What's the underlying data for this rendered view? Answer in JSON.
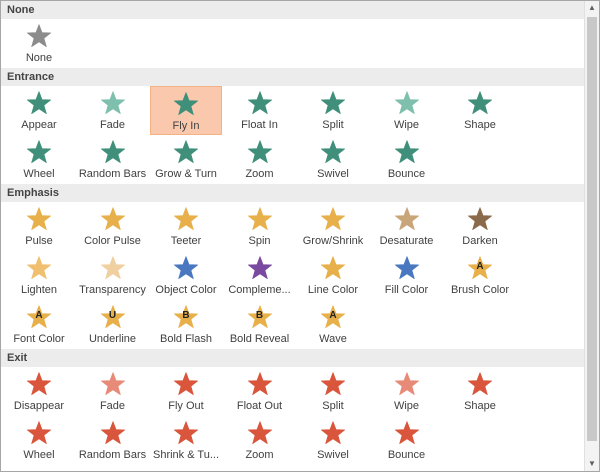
{
  "sections": [
    {
      "title": "None",
      "items": [
        {
          "label": "None",
          "icon": "star-gray-icon",
          "color": "#8c8c8c"
        }
      ]
    },
    {
      "title": "Entrance",
      "items": [
        {
          "label": "Appear",
          "icon": "star-appear-icon",
          "color": "#3f8f7a"
        },
        {
          "label": "Fade",
          "icon": "star-fade-icon",
          "color": "#7fbfae"
        },
        {
          "label": "Fly In",
          "icon": "star-fly-in-icon",
          "color": "#3f8f7a",
          "selected": true
        },
        {
          "label": "Float In",
          "icon": "star-float-in-icon",
          "color": "#3f8f7a"
        },
        {
          "label": "Split",
          "icon": "star-split-icon",
          "color": "#3f8f7a"
        },
        {
          "label": "Wipe",
          "icon": "star-wipe-icon",
          "color": "#7fbfae"
        },
        {
          "label": "Shape",
          "icon": "star-shape-icon",
          "color": "#3f8f7a"
        },
        {
          "label": "Wheel",
          "icon": "star-wheel-icon",
          "color": "#3f8f7a"
        },
        {
          "label": "Random Bars",
          "icon": "star-random-bars-icon",
          "color": "#3f8f7a"
        },
        {
          "label": "Grow & Turn",
          "icon": "star-grow-turn-icon",
          "color": "#3f8f7a"
        },
        {
          "label": "Zoom",
          "icon": "star-zoom-icon",
          "color": "#3f8f7a"
        },
        {
          "label": "Swivel",
          "icon": "star-swivel-icon",
          "color": "#3f8f7a"
        },
        {
          "label": "Bounce",
          "icon": "star-bounce-icon",
          "color": "#3f8f7a"
        }
      ]
    },
    {
      "title": "Emphasis",
      "items": [
        {
          "label": "Pulse",
          "icon": "star-pulse-icon",
          "color": "#e8b04a"
        },
        {
          "label": "Color Pulse",
          "icon": "star-color-pulse-icon",
          "color": "#e8b04a"
        },
        {
          "label": "Teeter",
          "icon": "star-teeter-icon",
          "color": "#e8b04a"
        },
        {
          "label": "Spin",
          "icon": "star-spin-icon",
          "color": "#e8b04a"
        },
        {
          "label": "Grow/Shrink",
          "icon": "star-grow-shrink-icon",
          "color": "#e8b04a"
        },
        {
          "label": "Desaturate",
          "icon": "star-desaturate-icon",
          "color": "#c9a679"
        },
        {
          "label": "Darken",
          "icon": "star-darken-icon",
          "color": "#8a6a4a"
        },
        {
          "label": "Lighten",
          "icon": "star-lighten-icon",
          "color": "#f0c070"
        },
        {
          "label": "Transparency",
          "icon": "star-transparency-icon",
          "color": "#f0d0a0"
        },
        {
          "label": "Object Color",
          "icon": "star-object-color-icon",
          "color": "#4a78c0"
        },
        {
          "label": "Compleme...",
          "icon": "star-complementary-icon",
          "color": "#7a4aa0"
        },
        {
          "label": "Line Color",
          "icon": "star-line-color-icon",
          "color": "#e8b04a"
        },
        {
          "label": "Fill Color",
          "icon": "star-fill-color-icon",
          "color": "#4a78c0"
        },
        {
          "label": "Brush Color",
          "icon": "star-brush-color-icon",
          "color": "#e8b04a",
          "letter": "A"
        },
        {
          "label": "Font Color",
          "icon": "star-font-color-icon",
          "color": "#e8b04a",
          "letter": "A"
        },
        {
          "label": "Underline",
          "icon": "star-underline-icon",
          "color": "#e8b04a",
          "letter": "U"
        },
        {
          "label": "Bold Flash",
          "icon": "star-bold-flash-icon",
          "color": "#e8b04a",
          "letter": "B"
        },
        {
          "label": "Bold Reveal",
          "icon": "star-bold-reveal-icon",
          "color": "#e8b04a",
          "letter": "B"
        },
        {
          "label": "Wave",
          "icon": "star-wave-icon",
          "color": "#e8b04a",
          "letter": "A"
        }
      ]
    },
    {
      "title": "Exit",
      "items": [
        {
          "label": "Disappear",
          "icon": "star-disappear-icon",
          "color": "#d9553b"
        },
        {
          "label": "Fade",
          "icon": "star-fade-out-icon",
          "color": "#e88a78"
        },
        {
          "label": "Fly Out",
          "icon": "star-fly-out-icon",
          "color": "#d9553b"
        },
        {
          "label": "Float Out",
          "icon": "star-float-out-icon",
          "color": "#d9553b"
        },
        {
          "label": "Split",
          "icon": "star-split-out-icon",
          "color": "#d9553b"
        },
        {
          "label": "Wipe",
          "icon": "star-wipe-out-icon",
          "color": "#e88a78"
        },
        {
          "label": "Shape",
          "icon": "star-shape-out-icon",
          "color": "#d9553b"
        },
        {
          "label": "Wheel",
          "icon": "star-wheel-out-icon",
          "color": "#d9553b"
        },
        {
          "label": "Random Bars",
          "icon": "star-random-bars-out-icon",
          "color": "#d9553b"
        },
        {
          "label": "Shrink & Tu...",
          "icon": "star-shrink-turn-icon",
          "color": "#d9553b"
        },
        {
          "label": "Zoom",
          "icon": "star-zoom-out-icon",
          "color": "#d9553b"
        },
        {
          "label": "Swivel",
          "icon": "star-swivel-out-icon",
          "color": "#d9553b"
        },
        {
          "label": "Bounce",
          "icon": "star-bounce-out-icon",
          "color": "#d9553b"
        }
      ]
    }
  ]
}
